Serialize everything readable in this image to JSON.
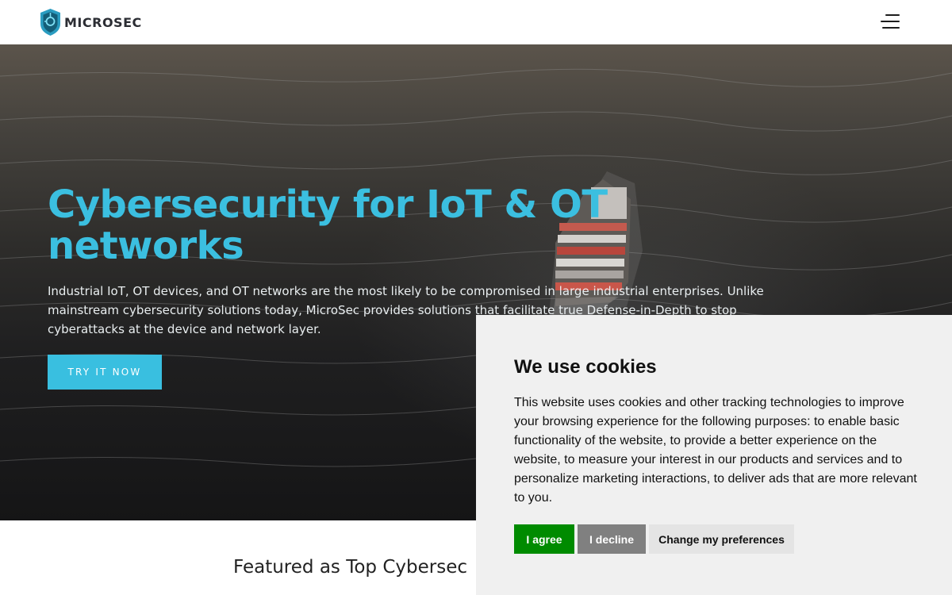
{
  "header": {
    "logo_text": "MICROSEC",
    "logo_icon": "shield-logo-icon",
    "menu_icon": "hamburger-menu-icon"
  },
  "hero": {
    "title": "Cybersecurity for IoT & OT networks",
    "description": "Industrial IoT, OT devices, and OT networks are the most likely to be compromised in large industrial enterprises. Unlike mainstream cybersecurity solutions today, MicroSec provides solutions that facilitate true Defense-in-Depth to stop cyberattacks at the device and network layer.",
    "cta_label": "TRY IT NOW"
  },
  "featured": {
    "heading": "Featured as Top Cybersec"
  },
  "cookie_banner": {
    "title": "We use cookies",
    "text": "This website uses cookies and other tracking technologies to improve your browsing experience for the following purposes: to enable basic functionality of the website, to provide a better experience on the website, to measure your interest in our products and services and to personalize marketing interactions, to deliver ads that are more relevant to you.",
    "agree_label": "I agree",
    "decline_label": "I decline",
    "preferences_label": "Change my preferences"
  },
  "colors": {
    "accent": "#39bfe0",
    "agree": "#008b00",
    "decline": "#808080",
    "banner_bg": "#f0f0f0"
  }
}
